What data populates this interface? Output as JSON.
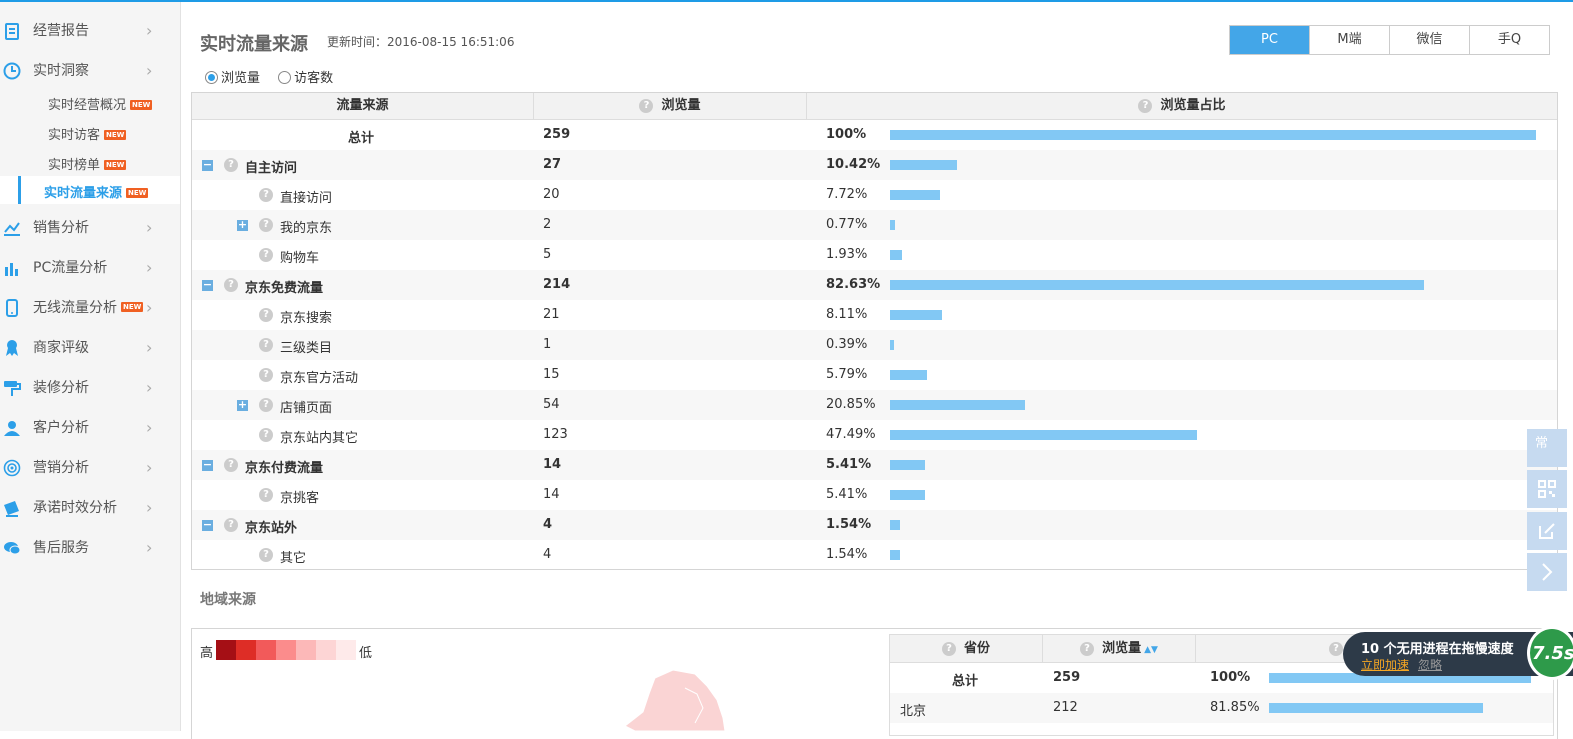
{
  "sidebar": {
    "items": [
      {
        "label": "经营报告",
        "icon": "report-icon"
      },
      {
        "label": "实时洞察",
        "icon": "clock-icon"
      },
      {
        "label": "销售分析",
        "icon": "line-chart-icon"
      },
      {
        "label": "PC流量分析",
        "icon": "bar-chart-icon"
      },
      {
        "label": "无线流量分析",
        "icon": "phone-icon",
        "badge": "NEW"
      },
      {
        "label": "商家评级",
        "icon": "ribbon-icon"
      },
      {
        "label": "装修分析",
        "icon": "paint-roller-icon"
      },
      {
        "label": "客户分析",
        "icon": "user-icon"
      },
      {
        "label": "营销分析",
        "icon": "target-icon"
      },
      {
        "label": "承诺时效分析",
        "icon": "truck-icon"
      },
      {
        "label": "售后服务",
        "icon": "chat-icon"
      }
    ],
    "sub_items": [
      {
        "label": "实时经营概况",
        "badge": "NEW"
      },
      {
        "label": "实时访客",
        "badge": "NEW"
      },
      {
        "label": "实时榜单",
        "badge": "NEW"
      },
      {
        "label": "实时流量来源",
        "badge": "NEW",
        "active": true
      }
    ]
  },
  "header": {
    "title": "实时流量来源",
    "update_time": "更新时间：2016-08-15 16:51:06",
    "tabs": [
      "PC",
      "M端",
      "微信",
      "手Q"
    ],
    "active_tab": "PC"
  },
  "metric_toggle": {
    "options": [
      "浏览量",
      "访客数"
    ],
    "selected": "浏览量"
  },
  "traffic_table": {
    "headers": [
      "流量来源",
      "浏览量",
      "浏览量占比"
    ],
    "rows": [
      {
        "source": "总计",
        "views": "259",
        "pct": "100%",
        "ratio": 1.0,
        "level": 0,
        "toggle": "",
        "bold": true
      },
      {
        "source": "自主访问",
        "views": "27",
        "pct": "10.42%",
        "ratio": 0.1042,
        "level": 1,
        "toggle": "−",
        "bold": true
      },
      {
        "source": "直接访问",
        "views": "20",
        "pct": "7.72%",
        "ratio": 0.0772,
        "level": 2,
        "toggle": "",
        "bold": false
      },
      {
        "source": "我的京东",
        "views": "2",
        "pct": "0.77%",
        "ratio": 0.0077,
        "level": 2,
        "toggle": "+",
        "bold": false
      },
      {
        "source": "购物车",
        "views": "5",
        "pct": "1.93%",
        "ratio": 0.0193,
        "level": 2,
        "toggle": "",
        "bold": false
      },
      {
        "source": "京东免费流量",
        "views": "214",
        "pct": "82.63%",
        "ratio": 0.8263,
        "level": 1,
        "toggle": "−",
        "bold": true
      },
      {
        "source": "京东搜索",
        "views": "21",
        "pct": "8.11%",
        "ratio": 0.0811,
        "level": 2,
        "toggle": "",
        "bold": false
      },
      {
        "source": "三级类目",
        "views": "1",
        "pct": "0.39%",
        "ratio": 0.0039,
        "level": 2,
        "toggle": "",
        "bold": false
      },
      {
        "source": "京东官方活动",
        "views": "15",
        "pct": "5.79%",
        "ratio": 0.0579,
        "level": 2,
        "toggle": "",
        "bold": false
      },
      {
        "source": "店铺页面",
        "views": "54",
        "pct": "20.85%",
        "ratio": 0.2085,
        "level": 2,
        "toggle": "+",
        "bold": false
      },
      {
        "source": "京东站内其它",
        "views": "123",
        "pct": "47.49%",
        "ratio": 0.4749,
        "level": 2,
        "toggle": "",
        "bold": false
      },
      {
        "source": "京东付费流量",
        "views": "14",
        "pct": "5.41%",
        "ratio": 0.0541,
        "level": 1,
        "toggle": "−",
        "bold": true
      },
      {
        "source": "京挑客",
        "views": "14",
        "pct": "5.41%",
        "ratio": 0.0541,
        "level": 2,
        "toggle": "",
        "bold": false
      },
      {
        "source": "京东站外",
        "views": "4",
        "pct": "1.54%",
        "ratio": 0.0154,
        "level": 1,
        "toggle": "−",
        "bold": true
      },
      {
        "source": "其它",
        "views": "4",
        "pct": "1.54%",
        "ratio": 0.0154,
        "level": 2,
        "toggle": "",
        "bold": false
      }
    ]
  },
  "region": {
    "title": "地域来源",
    "legend_high": "高",
    "legend_low": "低",
    "legend_colors": [
      "#a50f15",
      "#de2d26",
      "#f25a5a",
      "#fb8c8c",
      "#fcb8b8",
      "#fdd5d5",
      "#feeaea"
    ],
    "map_color": "#fad4d4",
    "table_headers": [
      "省份",
      "浏览量"
    ],
    "rows": [
      {
        "province": "总计",
        "views": "259",
        "pct": "100%",
        "ratio": 1.0,
        "bold": true
      },
      {
        "province": "北京",
        "views": "212",
        "pct": "81.85%",
        "ratio": 0.8185,
        "bold": false
      }
    ]
  },
  "float_toolbar": [
    {
      "icon": "frequent-icon",
      "text": "常"
    },
    {
      "icon": "qrcode-icon",
      "text": ""
    },
    {
      "icon": "edit-icon",
      "text": ""
    },
    {
      "icon": "chevron-right-icon",
      "text": ""
    }
  ],
  "popup": {
    "message": "10 个无用进程在拖慢速度",
    "action": "立即加速",
    "ignore": "忽略",
    "badge_text": "7.5s"
  }
}
